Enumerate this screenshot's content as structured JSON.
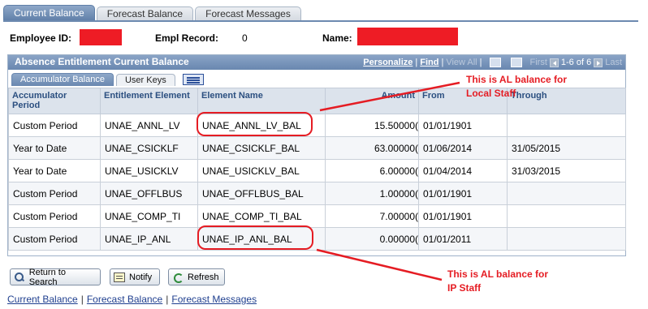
{
  "top_tabs": [
    {
      "label": "Current Balance",
      "active": true
    },
    {
      "label": "Forecast Balance",
      "active": false
    },
    {
      "label": "Forecast Messages",
      "active": false
    }
  ],
  "header": {
    "employee_id_label": "Employee ID:",
    "empl_record_label": "Empl Record:",
    "empl_record_value": "0",
    "name_label": "Name:"
  },
  "grid": {
    "title": "Absence Entitlement Current Balance",
    "nav": {
      "personalize": "Personalize",
      "find": "Find",
      "view_all": "View All",
      "first": "First",
      "range": "1-6 of 6",
      "last": "Last"
    },
    "sub_tabs": [
      {
        "label": "Accumulator Balance",
        "active": true
      },
      {
        "label": "User Keys",
        "active": false
      }
    ],
    "columns": [
      "Accumulator Period",
      "Entitlement Element",
      "Element Name",
      "Amount",
      "From",
      "Through"
    ],
    "rows": [
      {
        "period": "Custom Period",
        "entitlement": "UNAE_ANNL_LV",
        "element": "UNAE_ANNL_LV_BAL",
        "amount": "15.50000(",
        "from": "01/01/1901",
        "through": ""
      },
      {
        "period": "Year to Date",
        "entitlement": "UNAE_CSICKLF",
        "element": "UNAE_CSICKLF_BAL",
        "amount": "63.00000(",
        "from": "01/06/2014",
        "through": "31/05/2015"
      },
      {
        "period": "Year to Date",
        "entitlement": "UNAE_USICKLV",
        "element": "UNAE_USICKLV_BAL",
        "amount": "6.00000(",
        "from": "01/04/2014",
        "through": "31/03/2015"
      },
      {
        "period": "Custom Period",
        "entitlement": "UNAE_OFFLBUS",
        "element": "UNAE_OFFLBUS_BAL",
        "amount": "1.00000(",
        "from": "01/01/1901",
        "through": ""
      },
      {
        "period": "Custom Period",
        "entitlement": "UNAE_COMP_TI",
        "element": "UNAE_COMP_TI_BAL",
        "amount": "7.00000(",
        "from": "01/01/1901",
        "through": ""
      },
      {
        "period": "Custom Period",
        "entitlement": "UNAE_IP_ANL",
        "element": "UNAE_IP_ANL_BAL",
        "amount": "0.00000(",
        "from": "01/01/2011",
        "through": ""
      }
    ]
  },
  "annotations": {
    "local_staff_line1": "This is AL balance for",
    "local_staff_line2": "Local Staff",
    "ip_staff_line1": "This is AL balance for",
    "ip_staff_line2": "IP Staff",
    "color": "#e51c23"
  },
  "buttons": {
    "return_to_search": "Return to Search",
    "notify": "Notify",
    "refresh": "Refresh"
  },
  "footer_links": [
    "Current Balance",
    "Forecast Balance",
    "Forecast Messages"
  ],
  "colors": {
    "accent": "#6987b0",
    "redaction": "#ee1c25",
    "link": "#1f3f8f"
  }
}
